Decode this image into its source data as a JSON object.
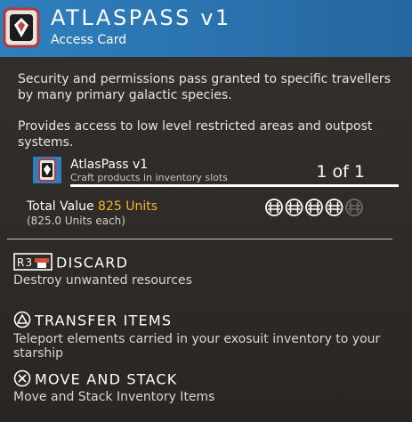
{
  "header": {
    "title": "ATLASPASS v1",
    "subtitle": "Access Card",
    "icon": "atlaspass-card-icon",
    "accent": "#2f7fbf"
  },
  "description": {
    "paragraph1": "Security and permissions pass granted to specific travellers by many primary galactic species.",
    "paragraph2": "Provides access to low level restricted areas and outpost systems."
  },
  "item": {
    "name": "AtlasPass v1",
    "hint": "Craft products in inventory slots",
    "count": "1 of 1",
    "icon": "atlaspass-card-icon"
  },
  "value": {
    "label": "Total Value",
    "amount": "825 Units",
    "each": "(825.0 Units each)",
    "amount_color": "#f2b72a",
    "coins_filled": 4,
    "coins_total": 5
  },
  "actions": [
    {
      "key": "R3",
      "title": "DISCARD",
      "desc": "Destroy unwanted resources",
      "icon": "r3-button-icon"
    },
    {
      "key": "triangle",
      "title": "TRANSFER ITEMS",
      "desc": "Teleport elements carried in your exosuit inventory to your starship",
      "icon": "triangle-button-icon"
    },
    {
      "key": "cross",
      "title": "MOVE AND STACK",
      "desc": "Move and Stack Inventory Items",
      "icon": "cross-button-icon"
    }
  ]
}
